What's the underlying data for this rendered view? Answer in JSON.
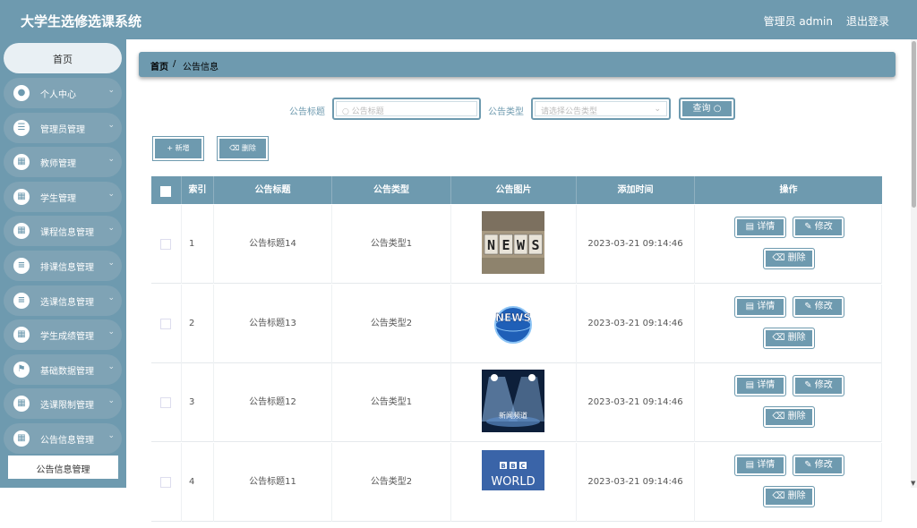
{
  "header": {
    "app_title": "大学生选修选课系统",
    "admin_label": "管理员 admin",
    "logout_label": "退出登录"
  },
  "sidebar": {
    "home_label": "首页",
    "items": [
      {
        "label": "个人中心",
        "icon": "user-icon"
      },
      {
        "label": "管理员管理",
        "icon": "sliders-icon"
      },
      {
        "label": "教师管理",
        "icon": "grid-icon"
      },
      {
        "label": "学生管理",
        "icon": "grid-icon"
      },
      {
        "label": "课程信息管理",
        "icon": "grid-icon"
      },
      {
        "label": "排课信息管理",
        "icon": "list-icon"
      },
      {
        "label": "选课信息管理",
        "icon": "list-icon"
      },
      {
        "label": "学生成绩管理",
        "icon": "grid-icon"
      },
      {
        "label": "基础数据管理",
        "icon": "flag-icon"
      },
      {
        "label": "选课限制管理",
        "icon": "grid-icon"
      },
      {
        "label": "公告信息管理",
        "icon": "grid-icon"
      }
    ],
    "submenu_label": "公告信息管理"
  },
  "breadcrumb": {
    "home": "首页",
    "sep": "/",
    "current": "公告信息"
  },
  "filters": {
    "title_label": "公告标题",
    "title_placeholder": "公告标题",
    "type_label": "公告类型",
    "type_placeholder": "请选择公告类型",
    "query_label": "查询"
  },
  "actions": {
    "add_label": "新增",
    "delete_label": "删除"
  },
  "table": {
    "headers": [
      "索引",
      "公告标题",
      "公告类型",
      "公告图片",
      "添加时间",
      "操作"
    ],
    "rows": [
      {
        "index": "1",
        "title": "公告标题14",
        "type": "公告类型1",
        "time": "2023-03-21 09:14:46",
        "image": "news-cubes",
        "image_text": "NEWS"
      },
      {
        "index": "2",
        "title": "公告标题13",
        "type": "公告类型2",
        "time": "2023-03-21 09:14:46",
        "image": "news-globe",
        "image_text": "NEWS"
      },
      {
        "index": "3",
        "title": "公告标题12",
        "type": "公告类型1",
        "time": "2023-03-21 09:14:46",
        "image": "news-stage",
        "image_text": "新闻频道"
      },
      {
        "index": "4",
        "title": "公告标题11",
        "type": "公告类型2",
        "time": "2023-03-21 09:14:46",
        "image": "bbc-world",
        "image_text": "BBC WORLD"
      }
    ],
    "op_detail": "详情",
    "op_edit": "修改",
    "op_delete": "删除"
  },
  "colors": {
    "primary": "#6e9aaf",
    "sidebar_item_bg": "#7fa3b5"
  }
}
